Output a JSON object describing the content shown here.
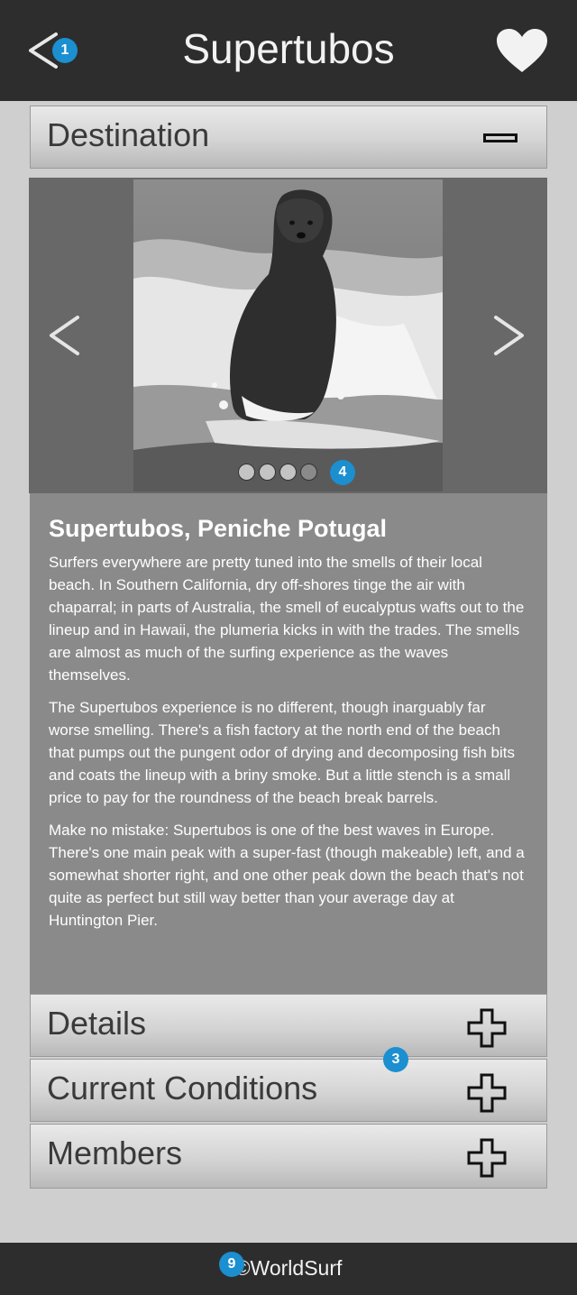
{
  "header": {
    "title": "Supertubos",
    "back_badge": "1"
  },
  "sections": {
    "destination": "Destination",
    "details": "Details",
    "current_conditions": "Current Conditions",
    "members": "Members",
    "section_badge": "3"
  },
  "carousel": {
    "dot_count": 4,
    "active_dot": 4,
    "badge": "4"
  },
  "article": {
    "title": "Supertubos, Peniche Potugal",
    "p1": "Surfers everywhere are pretty tuned into the smells of their local beach. In Southern California, dry off-shores tinge the air with chaparral; in parts of Australia, the smell of eucalyptus wafts out to the lineup and in Hawaii, the plumeria kicks in with the trades. The smells are almost as much of the surfing experience as the waves themselves.",
    "p2": "The Supertubos experience is no different, though inarguably far worse smelling. There's a fish factory at the north end of the beach that pumps out the pungent odor of drying and decomposing fish bits and coats the lineup with a briny smoke. But a little stench is a small price to pay for the roundness of the beach break barrels.",
    "p3": "Make no mistake: Supertubos is one of the best waves in Europe. There's one main peak with a super-fast (though makeable) left, and a somewhat shorter right, and one other peak down the beach that's not quite as perfect but still way better than your average day at Huntington Pier."
  },
  "footer": {
    "text": "©WorldSurf",
    "badge": "9"
  },
  "colors": {
    "topbar": "#2d2d2d",
    "badge": "#1b8fd0",
    "content_bg": "#8a8a8a",
    "page_bg": "#cfcfcf"
  },
  "icons": [
    "back-arrow-icon",
    "heart-icon",
    "minus-icon",
    "plus-icon",
    "chevron-left-icon",
    "chevron-right-icon"
  ]
}
